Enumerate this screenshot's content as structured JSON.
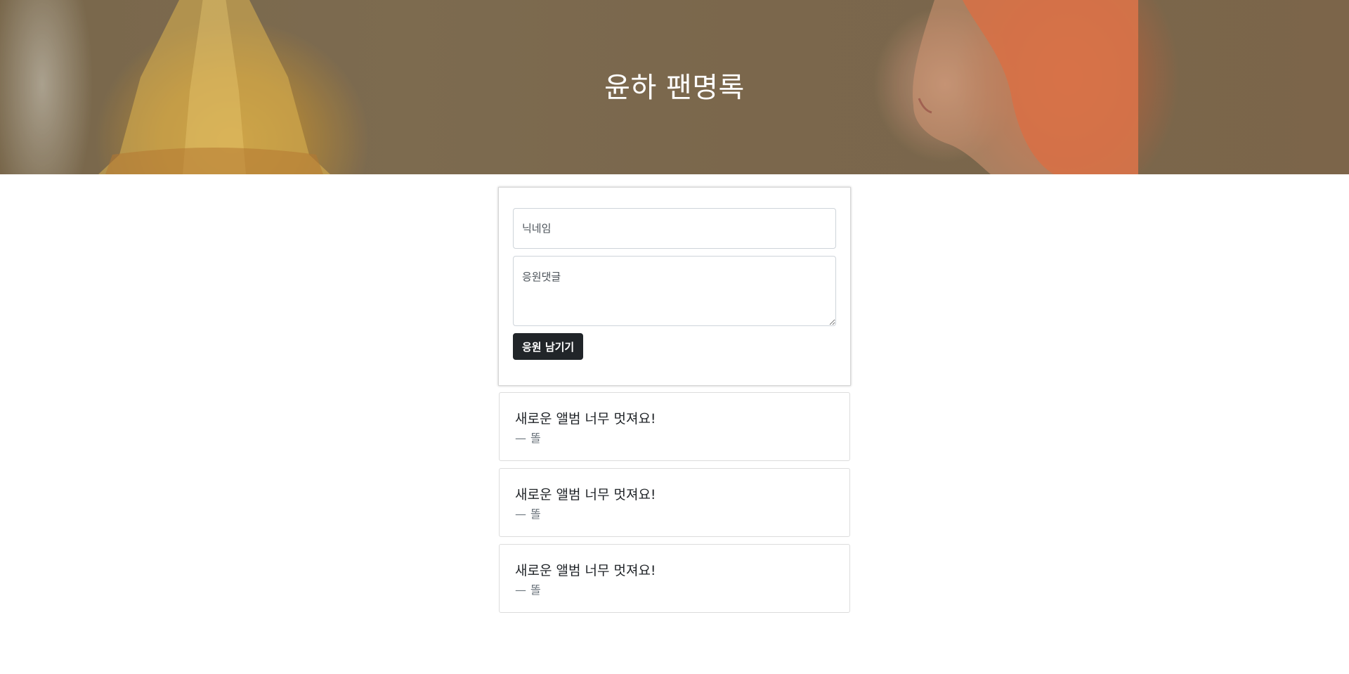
{
  "header": {
    "title": "윤하 팬명록"
  },
  "form": {
    "nickname_placeholder": "닉네임",
    "comment_placeholder": "응원댓글",
    "submit_label": "응원 남기기"
  },
  "comments": [
    {
      "text": "새로운 앨범 너무 멋져요!",
      "dash": "—",
      "author": "똘"
    },
    {
      "text": "새로운 앨범 너무 멋져요!",
      "dash": "—",
      "author": "똘"
    },
    {
      "text": "새로운 앨범 너무 멋져요!",
      "dash": "—",
      "author": "똘"
    }
  ]
}
